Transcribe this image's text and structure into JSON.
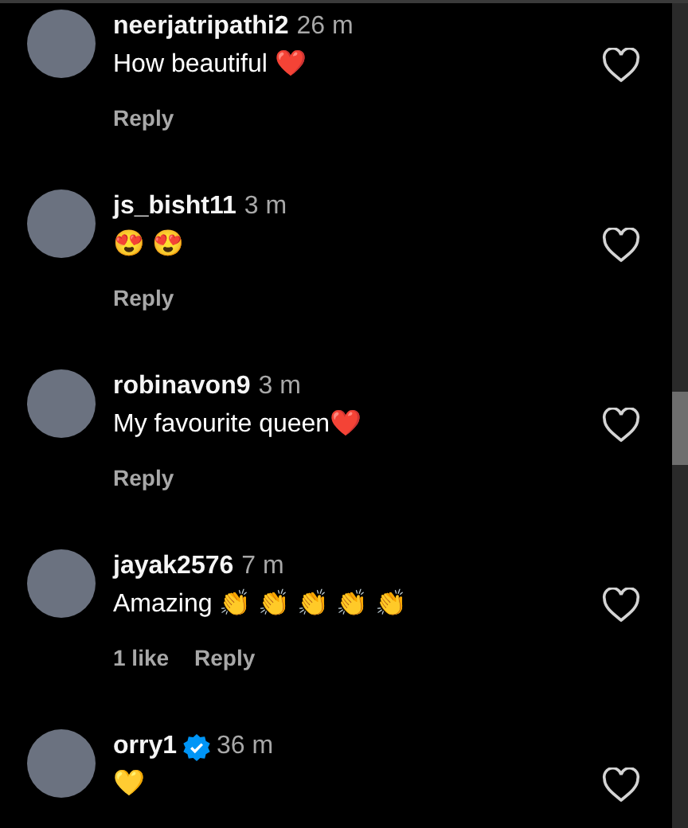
{
  "comments": [
    {
      "username": "neerjatripathi2",
      "verified": false,
      "time": "26 m",
      "text": "How beautiful  ❤️",
      "reply": "Reply"
    },
    {
      "username": "js_bisht11",
      "verified": false,
      "time": "3 m",
      "text": "😍 😍",
      "reply": "Reply"
    },
    {
      "username": "robinavon9",
      "verified": false,
      "time": "3 m",
      "text": "My favourite queen❤️",
      "reply": "Reply"
    },
    {
      "username": "jayak2576",
      "verified": false,
      "time": "7 m",
      "text": "Amazing  👏 👏 👏 👏 👏",
      "likes": "1 like",
      "reply": "Reply"
    },
    {
      "username": "orry1",
      "verified": true,
      "time": "36 m",
      "text": "💛"
    }
  ]
}
